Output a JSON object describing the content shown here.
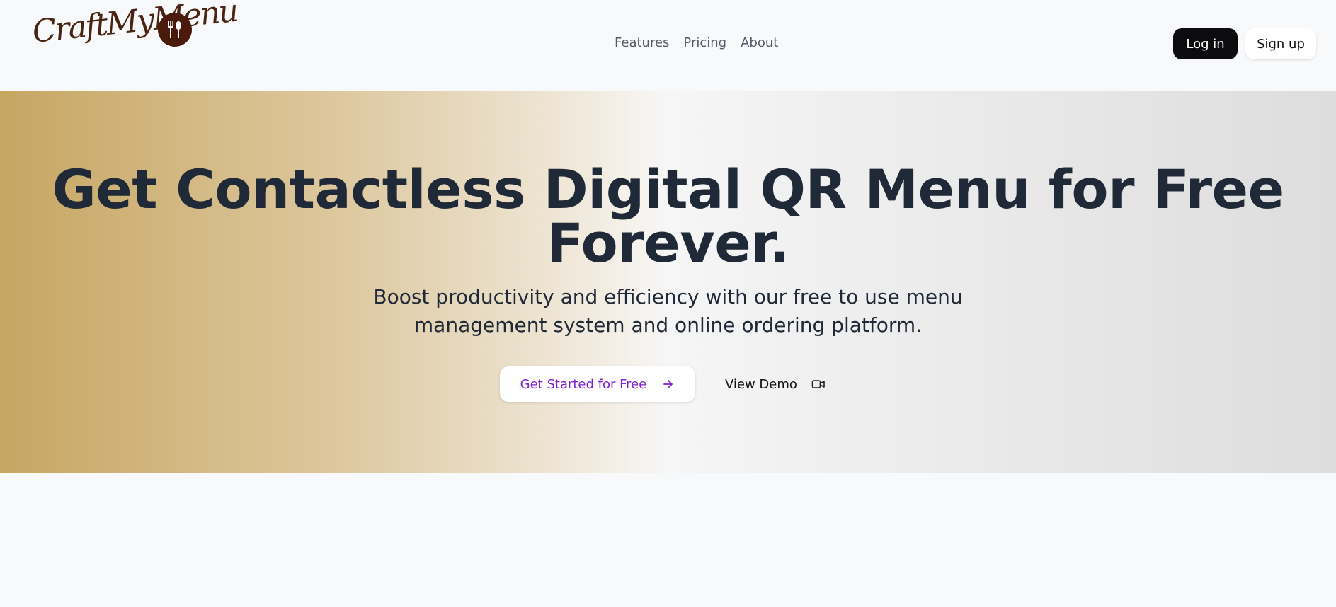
{
  "brand": {
    "logo_text": "CraftMyMenu",
    "logo_color": "#4a2412",
    "badge_color": "#4a1a0c",
    "badge_icon": "fork-spoon-icon"
  },
  "nav": {
    "items": [
      {
        "label": "Features"
      },
      {
        "label": "Pricing"
      },
      {
        "label": "About"
      }
    ]
  },
  "auth": {
    "login_label": "Log in",
    "signup_label": "Sign up"
  },
  "hero": {
    "title_line1": "Get Contactless Digital QR Menu for Free",
    "title_line2": "Forever.",
    "subtitle_line1": "Boost productivity and efficiency with our free to use menu",
    "subtitle_line2": "management system and online ordering platform.",
    "cta_primary": "Get Started for Free",
    "cta_primary_icon": "arrow-right-icon",
    "cta_secondary": "View Demo",
    "cta_secondary_icon": "video-camera-icon",
    "accent_color": "#7e22ce",
    "gradient_start": "#c6a662",
    "gradient_end": "#dddddd"
  }
}
